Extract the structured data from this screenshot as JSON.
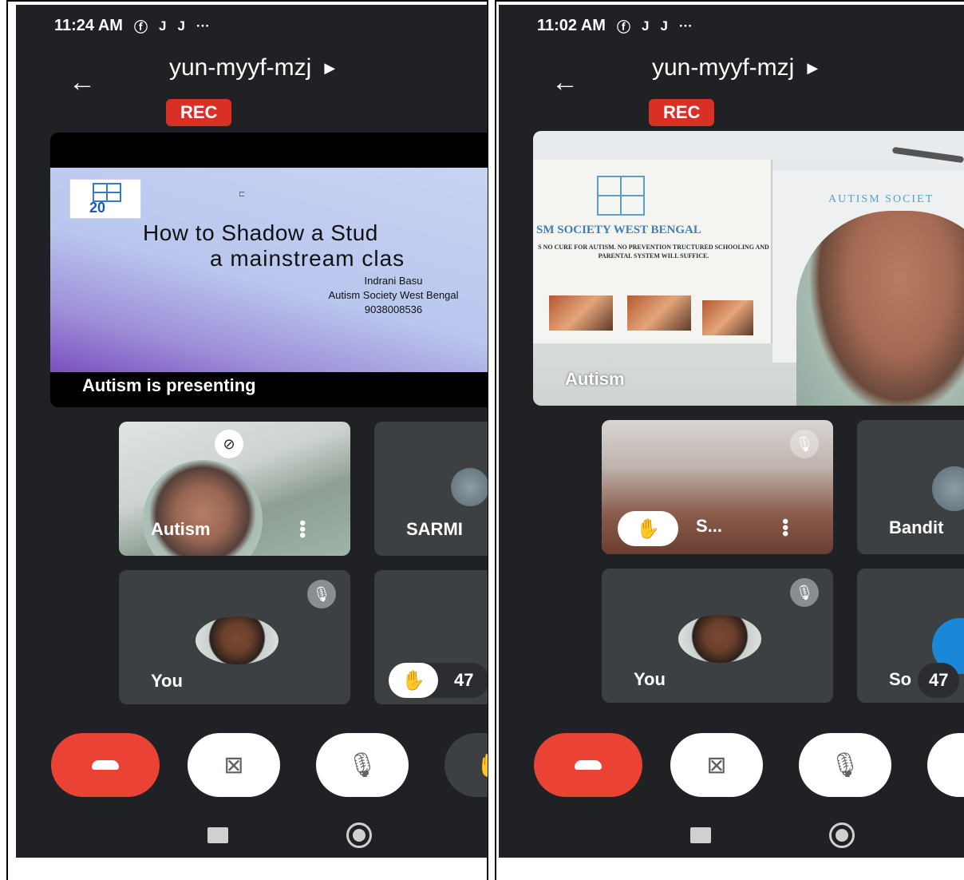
{
  "left": {
    "status": {
      "time": "11:24 AM",
      "icons": [
        "facebook-icon",
        "j-icon",
        "j-icon",
        "more-icon"
      ]
    },
    "meeting_code": "yun-myyf-mzj",
    "rec_label": "REC",
    "slide": {
      "title_line1": "How to Shadow a Stud",
      "title_line2": "a mainstream clas",
      "presenter": "Indrani Basu",
      "org": "Autism Society West Bengal",
      "phone": "9038008536",
      "logo_year": "20"
    },
    "presenting_label": "Autism  is presenting",
    "tiles": [
      {
        "name": "Autism"
      },
      {
        "name": "SARMI"
      },
      {
        "name": "You"
      },
      {
        "count": "47"
      }
    ]
  },
  "right": {
    "status": {
      "time": "11:02 AM",
      "icons": [
        "facebook-icon",
        "j-icon",
        "j-icon",
        "more-icon"
      ]
    },
    "meeting_code": "yun-myyf-mzj",
    "rec_label": "REC",
    "camera": {
      "banner_title": "SM SOCIETY WEST BENGAL",
      "banner_text": "S NO CURE FOR AUTISM. NO PREVENTION TRUCTURED SCHOOLING AND PARENTAL SYSTEM WILL SUFFICE.",
      "banner2_title": "AUTISM SOCIET",
      "name": "Autism"
    },
    "tiles": [
      {
        "name": "S..."
      },
      {
        "name": "Bandit"
      },
      {
        "name": "You"
      },
      {
        "name": "So",
        "count": "47"
      }
    ]
  },
  "colors": {
    "background": "#202124",
    "end_call": "#ea4335",
    "rec": "#d93025",
    "tile": "#3c4043"
  }
}
